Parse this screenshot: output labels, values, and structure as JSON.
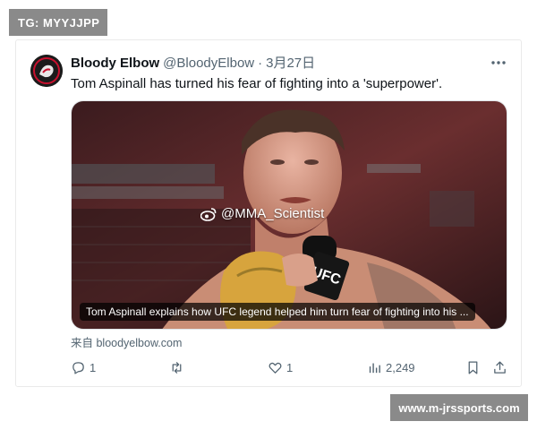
{
  "overlay": {
    "top_left_label": "TG: MYYJJPP",
    "bottom_right_label": "www.m-jrssports.com"
  },
  "tweet": {
    "display_name": "Bloody Elbow",
    "handle": "@BloodyElbow",
    "separator": "·",
    "date": "3月27日",
    "text": "Tom Aspinall has turned his fear of fighting into a 'superpower'.",
    "media": {
      "watermark": "@MMA_Scientist",
      "caption": "Tom Aspinall explains how UFC legend helped him turn fear of fighting into his ...",
      "mic_logo": "UFC"
    },
    "source_link": "来自 bloodyelbow.com",
    "actions": {
      "replies": "1",
      "retweets": "",
      "likes": "1",
      "views": "2,249"
    }
  },
  "icons": {
    "avatar": "bloody-elbow-logo-icon",
    "more": "more-horizontal-icon",
    "reply": "reply-icon",
    "retweet": "retweet-icon",
    "like": "heart-icon",
    "views": "bar-chart-icon",
    "bookmark": "bookmark-icon",
    "share": "share-icon",
    "weibo": "weibo-icon"
  },
  "colors": {
    "text_primary": "#0f1419",
    "text_secondary": "#536471",
    "badge_bg": "#8a8a8a",
    "brand_red": "#c8102e"
  }
}
